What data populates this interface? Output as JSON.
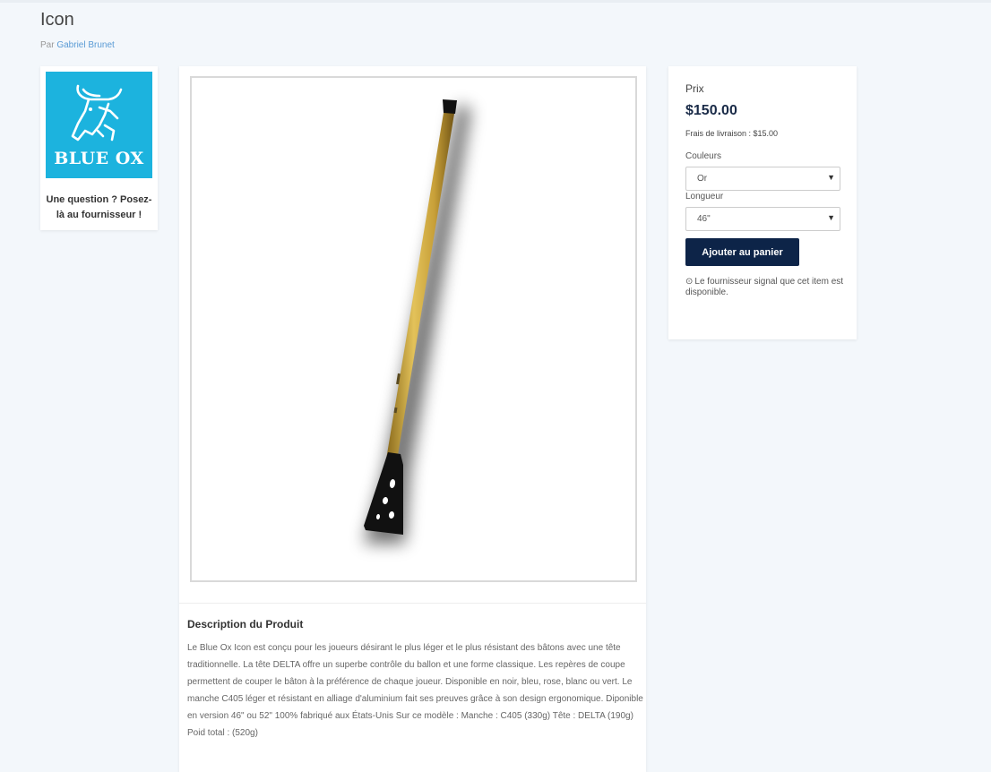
{
  "product": {
    "title": "Icon",
    "by_prefix": "Par",
    "vendor_name": "Gabriel Brunet"
  },
  "vendor": {
    "logo_text": "BLUE OX",
    "question_text": "Une question ? Posez-là au fournisseur !"
  },
  "description": {
    "title": "Description du Produit",
    "text": "Le Blue Ox Icon est conçu pour les joueurs désirant le plus léger et le plus résistant des bâtons avec une tête traditionnelle. La tête DELTA offre un superbe contrôle du ballon et une forme classique. Les repères de coupe permettent de couper le bâton à la préférence de chaque joueur. Disponible en noir, bleu, rose, blanc ou vert. Le manche C405 léger et résistant en alliage d'aluminium fait ses preuves grâce à son design ergonomique. Diponible en version 46\" ou 52\" 100% fabriqué aux États-Unis Sur ce modèle : Manche : C405 (330g) Tête : DELTA (190g) Poid total : (520g)"
  },
  "purchase": {
    "price_label": "Prix",
    "price": "$150.00",
    "shipping": "Frais de livraison : $15.00",
    "colors_label": "Couleurs",
    "color_selected": "Or",
    "length_label": "Longueur",
    "length_selected": "46\"",
    "add_to_cart": "Ajouter au panier",
    "availability": "Le fournisseur signal que cet item est disponible.",
    "availability_icon": "clock-icon"
  },
  "colors": {
    "accent": "#0d2448",
    "link": "#5a9bd5",
    "logo_bg": "#1cb3de"
  }
}
